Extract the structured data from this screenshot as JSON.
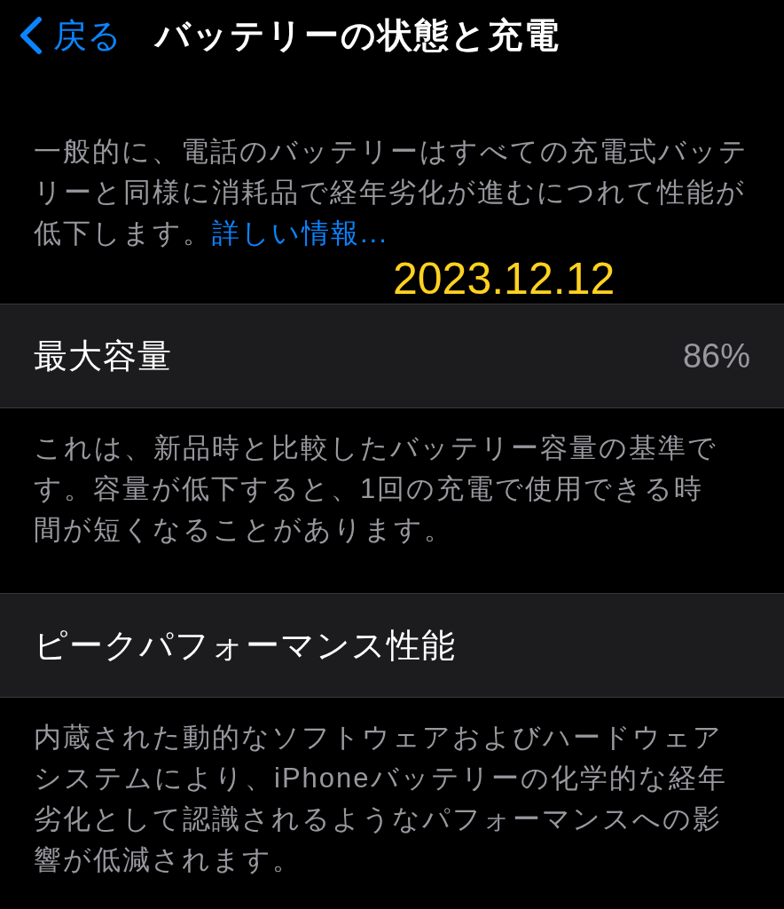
{
  "nav": {
    "back_label": "戻る",
    "title": "バッテリーの状態と充電"
  },
  "intro": {
    "text": "一般的に、電話のバッテリーはすべての充電式バッテリーと同様に消耗品で経年劣化が進むにつれて性能が低下します。",
    "link": "詳しい情報..."
  },
  "annotation": "2023.12.12",
  "sections": [
    {
      "label": "最大容量",
      "value": "86%",
      "footer": "これは、新品時と比較したバッテリー容量の基準です。容量が低下すると、1回の充電で使用できる時間が短くなることがあります。"
    },
    {
      "label": "ピークパフォーマンス性能",
      "footer": "内蔵された動的なソフトウェアおよびハードウェアシステムにより、iPhoneバッテリーの化学的な経年劣化として認識されるようなパフォーマンスへの影響が低減されます。"
    }
  ]
}
